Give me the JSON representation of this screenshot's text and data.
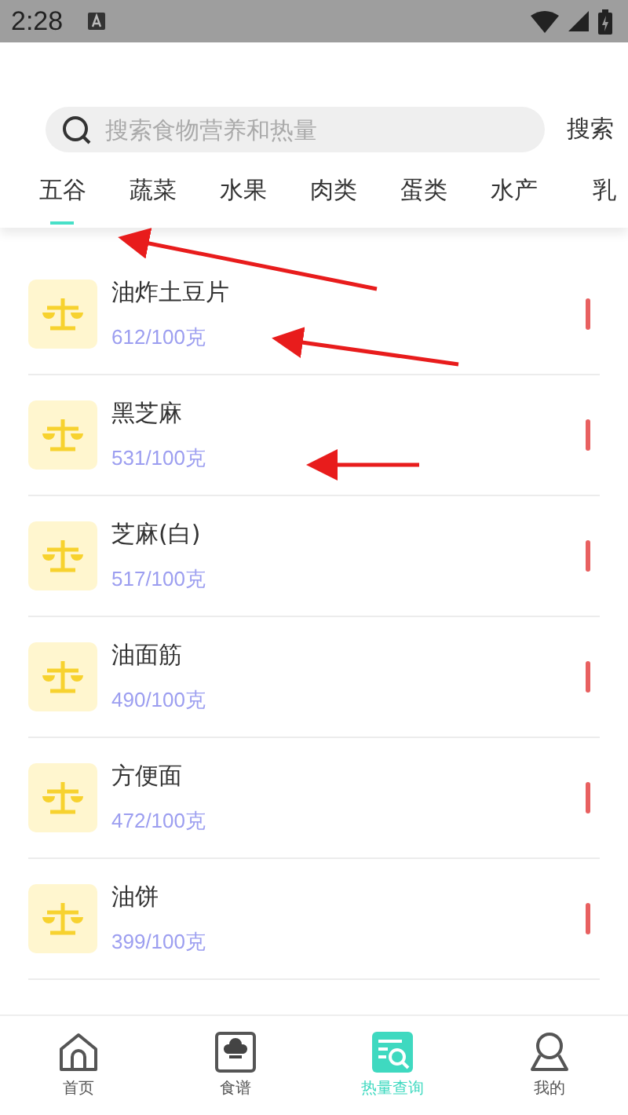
{
  "status_bar": {
    "time": "2:28"
  },
  "search": {
    "placeholder": "搜索食物营养和热量",
    "button": "搜索"
  },
  "tabs": [
    {
      "label": "五谷",
      "selected": true
    },
    {
      "label": "蔬菜",
      "selected": false
    },
    {
      "label": "水果",
      "selected": false
    },
    {
      "label": "肉类",
      "selected": false
    },
    {
      "label": "蛋类",
      "selected": false
    },
    {
      "label": "水产",
      "selected": false
    },
    {
      "label": "乳",
      "selected": false
    }
  ],
  "foods": [
    {
      "name": "油炸土豆片",
      "calories": "612/100克"
    },
    {
      "name": "黑芝麻",
      "calories": "531/100克"
    },
    {
      "name": "芝麻(白)",
      "calories": "517/100克"
    },
    {
      "name": "油面筋",
      "calories": "490/100克"
    },
    {
      "name": "方便面",
      "calories": "472/100克"
    },
    {
      "name": "油饼",
      "calories": "399/100克"
    }
  ],
  "bottom_nav": [
    {
      "label": "首页",
      "kind": "home",
      "selected": false
    },
    {
      "label": "食谱",
      "kind": "recipe",
      "selected": false
    },
    {
      "label": "热量查询",
      "kind": "calorie",
      "selected": true
    },
    {
      "label": "我的",
      "kind": "profile",
      "selected": false
    }
  ]
}
